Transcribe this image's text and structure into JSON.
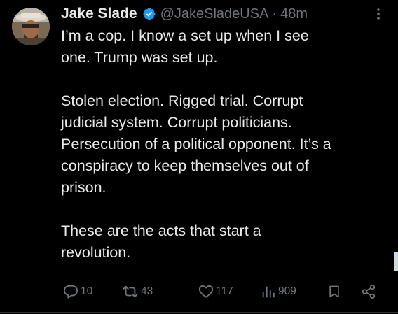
{
  "tweet": {
    "author": {
      "display_name": "Jake Slade",
      "handle": "@JakeSladeUSA",
      "verified": true,
      "avatar_icon": "avatar-photo"
    },
    "separator": "·",
    "time": "48m",
    "paragraphs": [
      "I’m a cop. I know a set up when I see\none. Trump was set up.",
      "Stolen election. Rigged trial. Corrupt\njudicial system. Corrupt politicians.\nPersecution of a political opponent. It’s a\nconspiracy to keep themselves out of\nprison.",
      "These are the acts that start a\nrevolution."
    ],
    "metrics": {
      "replies": "10",
      "reposts": "43",
      "likes": "117",
      "views": "909"
    },
    "icons": {
      "more": "more-options-icon",
      "reply": "reply-icon",
      "repost": "repost-icon",
      "like": "like-icon",
      "views": "views-icon",
      "bookmark": "bookmark-icon",
      "share": "share-icon"
    }
  },
  "colors": {
    "background": "#000000",
    "text_primary": "#e7e9ea",
    "text_secondary": "#71767b",
    "verified": "#1d9bf0"
  }
}
